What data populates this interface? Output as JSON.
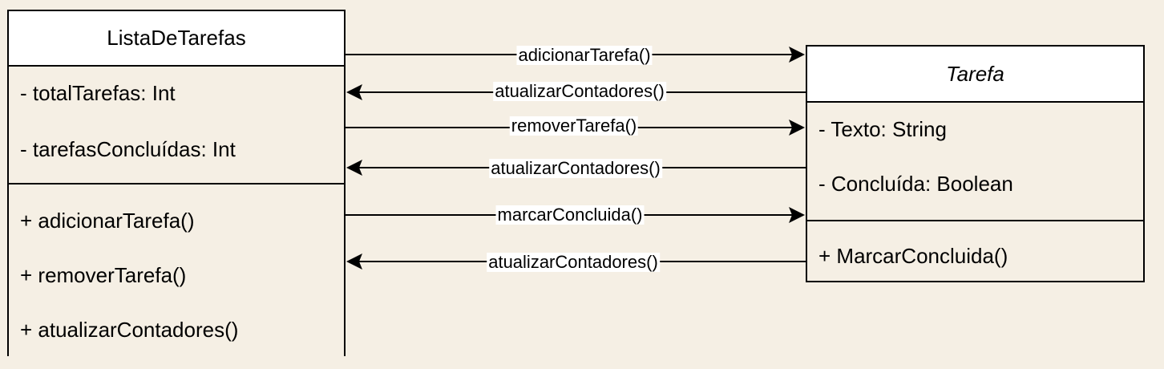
{
  "classes": {
    "lista": {
      "name": "ListaDeTarefas",
      "attributes": [
        "- totalTarefas: Int",
        "- tarefasConcluídas: Int"
      ],
      "methods": [
        "+ adicionarTarefa()",
        "+ removerTarefa()",
        "+ atualizarContadores()"
      ]
    },
    "tarefa": {
      "name": "Tarefa",
      "attributes": [
        "- Texto: String",
        "- Concluída: Boolean"
      ],
      "methods": [
        "+ MarcarConcluida()"
      ]
    }
  },
  "messages": [
    {
      "label": "adicionarTarefa()",
      "direction": "right"
    },
    {
      "label": "atualizarContadores()",
      "direction": "left"
    },
    {
      "label": "removerTarefa()",
      "direction": "right"
    },
    {
      "label": "atualizarContadores()",
      "direction": "left"
    },
    {
      "label": "marcarConcluida()",
      "direction": "right"
    },
    {
      "label": "atualizarContadores()",
      "direction": "left"
    }
  ]
}
